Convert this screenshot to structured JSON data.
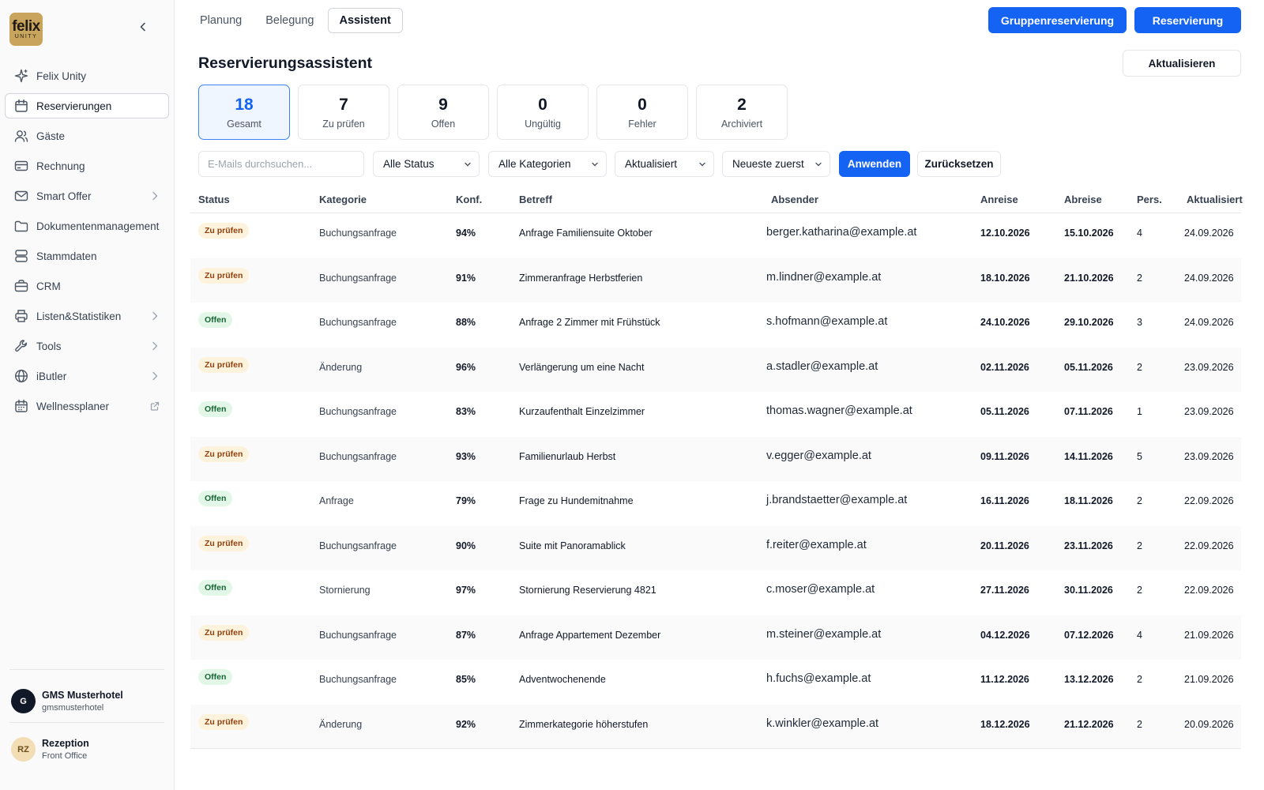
{
  "sidebar": {
    "logo": {
      "line1": "felix",
      "line2": "UNITY"
    },
    "items": [
      {
        "label": "Felix Unity",
        "icon": "sparkle-icon",
        "active": false
      },
      {
        "label": "Reservierungen",
        "icon": "calendar-icon",
        "active": true
      },
      {
        "label": "Gäste",
        "icon": "users-icon",
        "active": false
      },
      {
        "label": "Rechnung",
        "icon": "credit-card-icon",
        "active": false
      },
      {
        "label": "Smart Offer",
        "icon": "mail-icon",
        "active": false,
        "trail": "chevron-right-icon"
      },
      {
        "label": "Dokumentenmanagement",
        "icon": "folder-icon",
        "active": false
      },
      {
        "label": "Stammdaten",
        "icon": "database-icon",
        "active": false
      },
      {
        "label": "CRM",
        "icon": "briefcase-icon",
        "active": false
      },
      {
        "label": "Listen&Statistiken",
        "icon": "printer-icon",
        "active": false,
        "trail": "chevron-right-icon"
      },
      {
        "label": "Tools",
        "icon": "wrench-icon",
        "active": false,
        "trail": "chevron-right-icon"
      },
      {
        "label": "iButler",
        "icon": "globe-icon",
        "active": false,
        "trail": "chevron-right-icon"
      },
      {
        "label": "Wellnessplaner",
        "icon": "calendar-grid-icon",
        "active": false,
        "trail": "external-link-icon"
      }
    ],
    "hotel": {
      "initial": "G",
      "name": "GMS Musterhotel",
      "handle": "gmsmusterhotel"
    },
    "user": {
      "initials": "RZ",
      "name": "Rezeption",
      "role": "Front Office"
    }
  },
  "tabs": [
    {
      "label": "Planung",
      "active": false
    },
    {
      "label": "Belegung",
      "active": false
    },
    {
      "label": "Assistent",
      "active": true
    }
  ],
  "actions": {
    "group_reservation": "Gruppenreservierung",
    "reservation": "Reservierung",
    "refresh": "Aktualisieren"
  },
  "page_title": "Reservierungsassistent",
  "stats": [
    {
      "value": "18",
      "label": "Gesamt",
      "active": true
    },
    {
      "value": "7",
      "label": "Zu prüfen",
      "active": false
    },
    {
      "value": "9",
      "label": "Offen",
      "active": false
    },
    {
      "value": "0",
      "label": "Ungültig",
      "active": false
    },
    {
      "value": "0",
      "label": "Fehler",
      "active": false
    },
    {
      "value": "2",
      "label": "Archiviert",
      "active": false
    }
  ],
  "filters": {
    "search_placeholder": "E-Mails durchsuchen...",
    "search_value": "",
    "status": "Alle Status",
    "category": "Alle Kategorien",
    "date_field": "Aktualisiert",
    "sort": "Neueste zuerst",
    "apply": "Anwenden",
    "reset": "Zurücksetzen"
  },
  "table": {
    "columns": [
      "Status",
      "Kategorie",
      "Konf.",
      "Betreff",
      "Absender",
      "Anreise",
      "Abreise",
      "Pers.",
      "Aktualisiert"
    ],
    "rows": [
      {
        "status": "Zu prüfen",
        "kind": "warn",
        "category": "Buchungsanfrage",
        "conf": "94%",
        "subject": "Anfrage Familiensuite Oktober",
        "sender": "berger.katharina@example.at",
        "arrival": "12.10.2026",
        "departure": "15.10.2026",
        "persons": "4",
        "updated": "24.09.2026"
      },
      {
        "status": "Zu prüfen",
        "kind": "warn",
        "category": "Buchungsanfrage",
        "conf": "91%",
        "subject": "Zimmeranfrage Herbstferien",
        "sender": "m.lindner@example.at",
        "arrival": "18.10.2026",
        "departure": "21.10.2026",
        "persons": "2",
        "updated": "24.09.2026"
      },
      {
        "status": "Offen",
        "kind": "ok",
        "category": "Buchungsanfrage",
        "conf": "88%",
        "subject": "Anfrage 2 Zimmer mit Frühstück",
        "sender": "s.hofmann@example.at",
        "arrival": "24.10.2026",
        "departure": "29.10.2026",
        "persons": "3",
        "updated": "24.09.2026"
      },
      {
        "status": "Zu prüfen",
        "kind": "warn",
        "category": "Änderung",
        "conf": "96%",
        "subject": "Verlängerung um eine Nacht",
        "sender": "a.stadler@example.at",
        "arrival": "02.11.2026",
        "departure": "05.11.2026",
        "persons": "2",
        "updated": "23.09.2026"
      },
      {
        "status": "Offen",
        "kind": "ok",
        "category": "Buchungsanfrage",
        "conf": "83%",
        "subject": "Kurzaufenthalt Einzelzimmer",
        "sender": "thomas.wagner@example.at",
        "arrival": "05.11.2026",
        "departure": "07.11.2026",
        "persons": "1",
        "updated": "23.09.2026"
      },
      {
        "status": "Zu prüfen",
        "kind": "warn",
        "category": "Buchungsanfrage",
        "conf": "93%",
        "subject": "Familienurlaub Herbst",
        "sender": "v.egger@example.at",
        "arrival": "09.11.2026",
        "departure": "14.11.2026",
        "persons": "5",
        "updated": "23.09.2026"
      },
      {
        "status": "Offen",
        "kind": "ok",
        "category": "Anfrage",
        "conf": "79%",
        "subject": "Frage zu Hundemitnahme",
        "sender": "j.brandstaetter@example.at",
        "arrival": "16.11.2026",
        "departure": "18.11.2026",
        "persons": "2",
        "updated": "22.09.2026"
      },
      {
        "status": "Zu prüfen",
        "kind": "warn",
        "category": "Buchungsanfrage",
        "conf": "90%",
        "subject": "Suite mit Panoramablick",
        "sender": "f.reiter@example.at",
        "arrival": "20.11.2026",
        "departure": "23.11.2026",
        "persons": "2",
        "updated": "22.09.2026"
      },
      {
        "status": "Offen",
        "kind": "ok",
        "category": "Stornierung",
        "conf": "97%",
        "subject": "Stornierung Reservierung 4821",
        "sender": "c.moser@example.at",
        "arrival": "27.11.2026",
        "departure": "30.11.2026",
        "persons": "2",
        "updated": "22.09.2026"
      },
      {
        "status": "Zu prüfen",
        "kind": "warn",
        "category": "Buchungsanfrage",
        "conf": "87%",
        "subject": "Anfrage Appartement Dezember",
        "sender": "m.steiner@example.at",
        "arrival": "04.12.2026",
        "departure": "07.12.2026",
        "persons": "4",
        "updated": "21.09.2026"
      },
      {
        "status": "Offen",
        "kind": "ok",
        "category": "Buchungsanfrage",
        "conf": "85%",
        "subject": "Adventwochenende",
        "sender": "h.fuchs@example.at",
        "arrival": "11.12.2026",
        "departure": "13.12.2026",
        "persons": "2",
        "updated": "21.09.2026"
      },
      {
        "status": "Zu prüfen",
        "kind": "warn",
        "category": "Änderung",
        "conf": "92%",
        "subject": "Zimmerkategorie höherstufen",
        "sender": "k.winkler@example.at",
        "arrival": "18.12.2026",
        "departure": "21.12.2026",
        "persons": "2",
        "updated": "20.09.2026"
      }
    ]
  }
}
